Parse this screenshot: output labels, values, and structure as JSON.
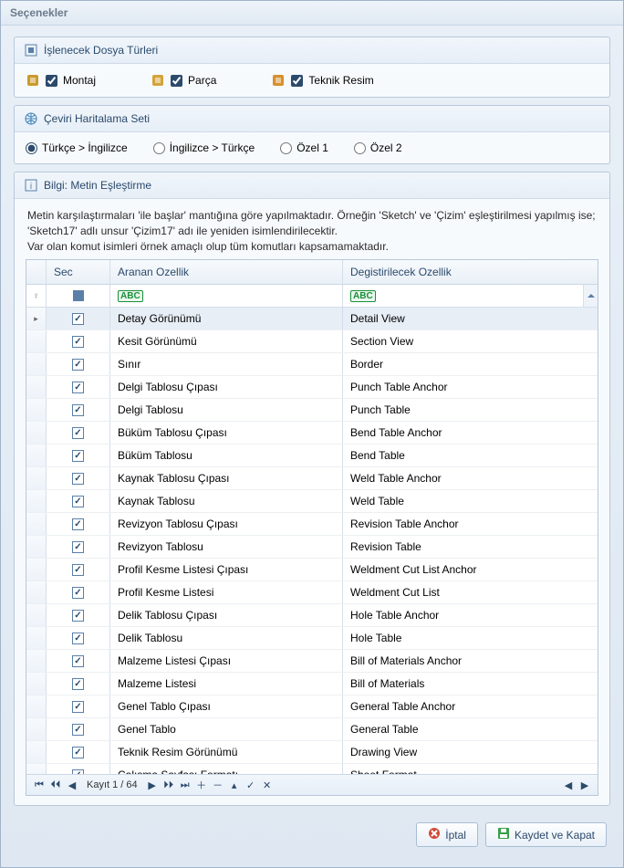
{
  "window": {
    "title": "Seçenekler"
  },
  "panel_filetypes": {
    "title": "İşlenecek Dosya Türleri",
    "items": [
      {
        "label": "Montaj",
        "checked": true,
        "icon": "assembly-icon",
        "color": "#c99a2e"
      },
      {
        "label": "Parça",
        "checked": true,
        "icon": "part-icon",
        "color": "#d4a33b"
      },
      {
        "label": "Teknik Resim",
        "checked": true,
        "icon": "drawing-icon",
        "color": "#d98f2e"
      }
    ]
  },
  "panel_mapping": {
    "title": "Çeviri Haritalama Seti",
    "options": [
      {
        "label": "Türkçe > İngilizce",
        "selected": true
      },
      {
        "label": "İngilizce > Türkçe",
        "selected": false
      },
      {
        "label": "Özel 1",
        "selected": false
      },
      {
        "label": "Özel 2",
        "selected": false
      }
    ]
  },
  "panel_info": {
    "title": "Bilgi: Metin Eşleştirme",
    "paragraph": "Metin karşılaştırmaları 'ile başlar' mantığına göre yapılmaktadır. Örneğin 'Sketch' ve 'Çizim' eşleştirilmesi yapılmış ise; 'Sketch17' adlı unsur 'Çizim17' adı ile yeniden isimlendirilecektir.\nVar olan komut isimleri örnek amaçlı olup tüm komutları kapsamamaktadır."
  },
  "grid": {
    "columns": {
      "sec": "Sec",
      "src": "Aranan Ozellik",
      "dst": "Degistirilecek Ozellik"
    },
    "rows": [
      {
        "sec": true,
        "src": "Detay Görünümü",
        "dst": "Detail View",
        "current": true
      },
      {
        "sec": true,
        "src": "Kesit Görünümü",
        "dst": "Section View"
      },
      {
        "sec": true,
        "src": "Sınır",
        "dst": "Border"
      },
      {
        "sec": true,
        "src": "Delgi Tablosu Çıpası",
        "dst": "Punch Table Anchor"
      },
      {
        "sec": true,
        "src": "Delgi Tablosu",
        "dst": "Punch Table"
      },
      {
        "sec": true,
        "src": "Büküm Tablosu Çıpası",
        "dst": "Bend Table Anchor"
      },
      {
        "sec": true,
        "src": "Büküm Tablosu",
        "dst": "Bend Table"
      },
      {
        "sec": true,
        "src": "Kaynak Tablosu Çıpası",
        "dst": "Weld Table Anchor"
      },
      {
        "sec": true,
        "src": "Kaynak Tablosu",
        "dst": "Weld Table"
      },
      {
        "sec": true,
        "src": "Revizyon Tablosu Çıpası",
        "dst": "Revision Table Anchor"
      },
      {
        "sec": true,
        "src": "Revizyon Tablosu",
        "dst": "Revision Table"
      },
      {
        "sec": true,
        "src": "Profil Kesme Listesi Çıpası",
        "dst": "Weldment Cut List Anchor"
      },
      {
        "sec": true,
        "src": "Profil Kesme Listesi",
        "dst": "Weldment Cut List"
      },
      {
        "sec": true,
        "src": "Delik Tablosu Çıpası",
        "dst": "Hole Table Anchor"
      },
      {
        "sec": true,
        "src": "Delik Tablosu",
        "dst": "Hole Table"
      },
      {
        "sec": true,
        "src": "Malzeme Listesi Çıpası",
        "dst": "Bill of Materials Anchor"
      },
      {
        "sec": true,
        "src": "Malzeme Listesi",
        "dst": "Bill of Materials"
      },
      {
        "sec": true,
        "src": "Genel Tablo Çıpası",
        "dst": "General Table Anchor"
      },
      {
        "sec": true,
        "src": "Genel Tablo",
        "dst": "General Table"
      },
      {
        "sec": true,
        "src": "Teknik Resim Görünümü",
        "dst": "Drawing View"
      },
      {
        "sec": true,
        "src": "Çalışma Sayfası Formatı",
        "dst": "Sheet Format"
      }
    ],
    "record_label": "Kayıt 1 / 64"
  },
  "buttons": {
    "cancel": "İptal",
    "save": "Kaydet ve Kapat"
  },
  "filter_badge": "ABC"
}
